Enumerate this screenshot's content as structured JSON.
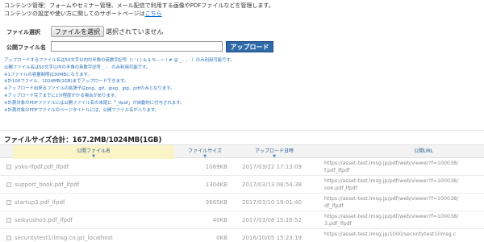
{
  "intro": {
    "line1": "コンテンツ管理：フォームやセミナー管理、メール配信で利用する画像やPDFファイルなどを管理します。",
    "line2_prefix": "コンテンツの設定や使い方に関してのサポートページは",
    "line2_link": "こちら"
  },
  "upload_form": {
    "file_label": "ファイル選択",
    "file_button": "ファイルを選択",
    "file_status": "選択されていません",
    "name_label": "公開ファイル名",
    "name_value": "",
    "upload_button": "アップロード"
  },
  "notes": [
    "アップロードするファイル名は50文字以内の半角の英数字記号（! ' ( ) & $ % - ~ ! # @ _ . , - ）のみ利用可能です。",
    "公開ファイル名は50文字以内の半角の英数字記号 _ - . のみ利用可能です。",
    "※1ファイルの容量制限は30MBになります。",
    "※計100ファイル、1024MB(1GB)までアップロードできます。",
    "※アップロード出来るファイルの拡張子はpng、gif、jpeg、jpg、pdfのみとなります。",
    "※アップロード完了までに1分程度かかる場合があります。",
    "※計測対象のPDFファイルには公開ファイル名の末尾に「_lfpdf」が自動的に付与されます。",
    "※計測対象のPDFファイルのページタイトルには、公開ファイル名が入ります。"
  ],
  "summary": "ファイルサイズ合計：167.2MB/1024MB(1GB)",
  "table": {
    "columns": [
      "公開ファイル名",
      "ファイルサイズ",
      "アップロード日時",
      "公開URL"
    ],
    "sort_indicator": "▼",
    "rows": [
      {
        "name": "yoko-lfpdf.pdf_lfpdf",
        "size": "1069KB",
        "date": "2017/03/22 17:13:09",
        "url1": "https://asset-test.lmsg.jp/pdf/web/viewer?f=100038/",
        "url2": "f.pdf_lfpdf"
      },
      {
        "name": "support_book.pdf_lfpdf",
        "size": "1304KB",
        "date": "2017/03/13 08:54:38",
        "url1": "https://asset-test.lmsg.jp/pdf/web/viewer?f=100038/",
        "url2": "ook.pdf_lfpdf"
      },
      {
        "name": "startup3.pdf_lfpdf",
        "size": "3665KB",
        "date": "2017/03/10 19:01:40",
        "url1": "https://asset-test.lmsg.jp/pdf/web/viewer?f=100038/",
        "url2": "df_lfpdf"
      },
      {
        "name": "seikyusho3.pdf_lfpdf",
        "size": "40KB",
        "date": "2017/03/08 15:16:52",
        "url1": "https://asset-test.lmsg.jp/pdf/web/viewer?f=100038/",
        "url2": "3.pdf_lfpdf"
      },
      {
        "name": "securitytest1(lmsg.co.jp)_localhost",
        "size": "0KB",
        "date": "2016/10/05 15:23:19",
        "url1": "https://asset-test.lmsg.jp/1000/securitytest1(lmsg.c",
        "url2": ""
      }
    ]
  }
}
